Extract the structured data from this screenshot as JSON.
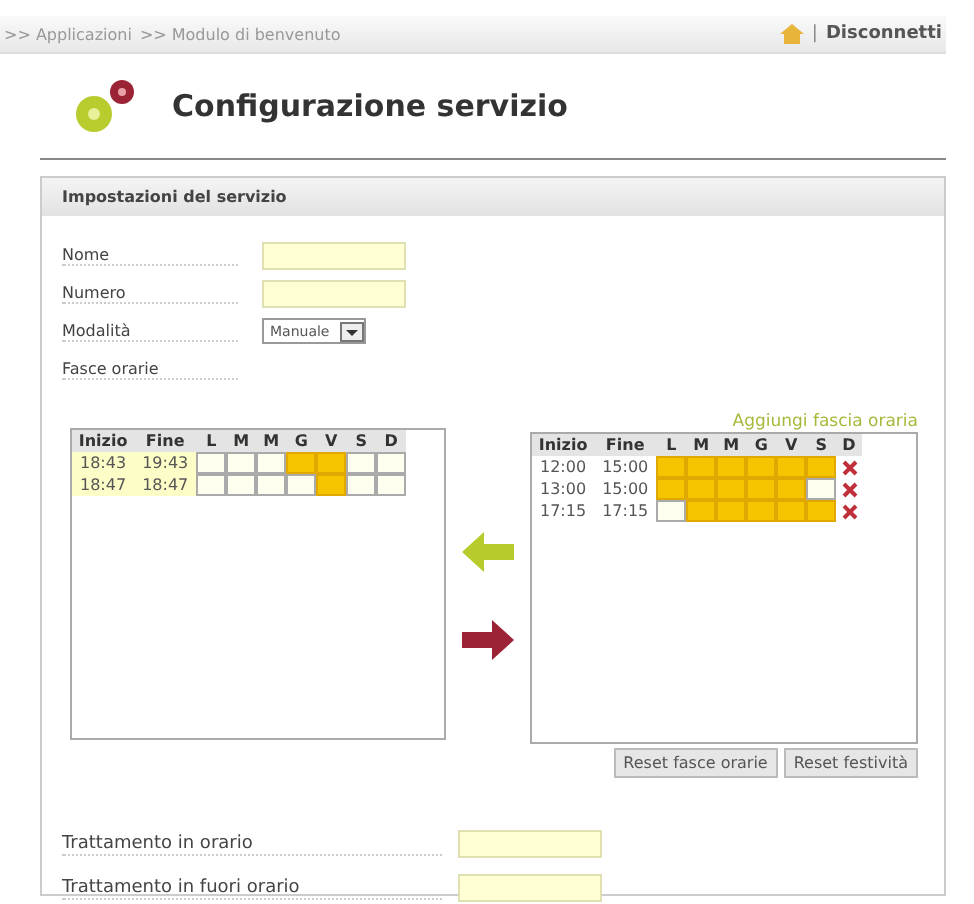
{
  "breadcrumb": [
    ">> Applicazioni",
    ">> Modulo di benvenuto"
  ],
  "logout": {
    "separator": "|",
    "label": "Disconnetti"
  },
  "title": "Configurazione servizio",
  "section": {
    "title": "Impostazioni del servizio"
  },
  "fields": [
    {
      "label": "Nome",
      "kind": "text"
    },
    {
      "label": "Numero",
      "kind": "text"
    },
    {
      "label": "Modalità",
      "kind": "select",
      "value": "Manuale"
    },
    {
      "label": "Fasce orarie",
      "kind": "none"
    }
  ],
  "columns": [
    "Inizio",
    "Fine",
    "L",
    "M",
    "M",
    "G",
    "V",
    "S",
    "D"
  ],
  "left_slots": [
    {
      "start": "18:43",
      "end": "19:43",
      "days": [
        false,
        false,
        false,
        true,
        true,
        false,
        false
      ]
    },
    {
      "start": "18:47",
      "end": "18:47",
      "days": [
        false,
        false,
        false,
        false,
        true,
        false,
        false
      ]
    }
  ],
  "add_slot_link": "Aggiungi fascia oraria",
  "right_columns": [
    "Inizio",
    "Fine",
    "L",
    "M",
    "M",
    "G",
    "V",
    "S",
    "D"
  ],
  "right_slots": [
    {
      "start": "12:00",
      "end": "15:00",
      "days": [
        true,
        true,
        true,
        true,
        true,
        true
      ]
    },
    {
      "start": "13:00",
      "end": "15:00",
      "days": [
        true,
        true,
        true,
        true,
        true,
        false
      ]
    },
    {
      "start": "17:15",
      "end": "17:15",
      "days": [
        false,
        true,
        true,
        true,
        true,
        true
      ]
    }
  ],
  "buttons": [
    "Reset fasce orarie",
    "Reset festività"
  ],
  "treatments": [
    {
      "label": "Trattamento in orario"
    },
    {
      "label": "Trattamento in fuori orario"
    }
  ]
}
